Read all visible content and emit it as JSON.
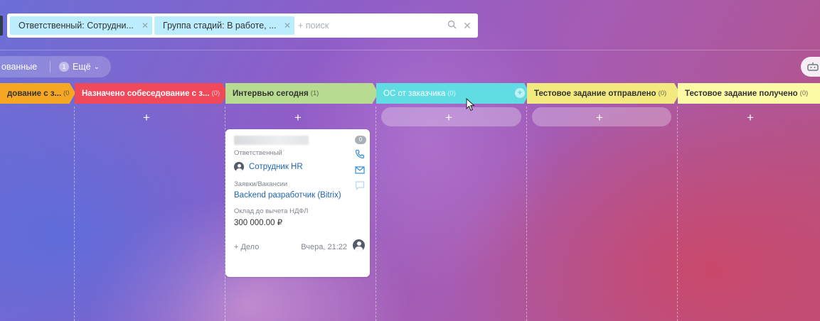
{
  "filter_bar": {
    "chips": [
      {
        "label": "Ответственный: Сотрудни..."
      },
      {
        "label": "Группа стадий: В работе, ..."
      }
    ],
    "search_placeholder": "+ поиск"
  },
  "views": {
    "label": "ованные",
    "count": "1",
    "more_label": "Ещё"
  },
  "stages": [
    {
      "title": "дование с з...",
      "count": "(0)",
      "color": "#f5a623"
    },
    {
      "title": "Назначено собеседование с з...",
      "count": "(0)",
      "color": "#f04a5a"
    },
    {
      "title": "Интервью сегодня",
      "count": "(1)",
      "color": "#b7dc8f"
    },
    {
      "title": "ОС от заказчика",
      "count": "(0)",
      "color": "#5fdde3"
    },
    {
      "title": "Тестовое задание отправлено",
      "count": "(0)",
      "color": "#f2ea7e"
    },
    {
      "title": "Тестовое задание получено",
      "count": "(0)",
      "color": "#fdfaa6"
    }
  ],
  "plus_symbol": "+",
  "card": {
    "badge": "0",
    "responsible_label": "Ответственный",
    "responsible_name": "Сотрудник HR",
    "vacancy_label": "Заявки/Вакансии",
    "vacancy_value": "Backend разработчик (Bitrix)",
    "salary_label": "Оклад до вычета НДФЛ",
    "salary_value": "300 000.00 ₽",
    "add_activity": "+ Дело",
    "timestamp": "Вчера, 21:22"
  }
}
